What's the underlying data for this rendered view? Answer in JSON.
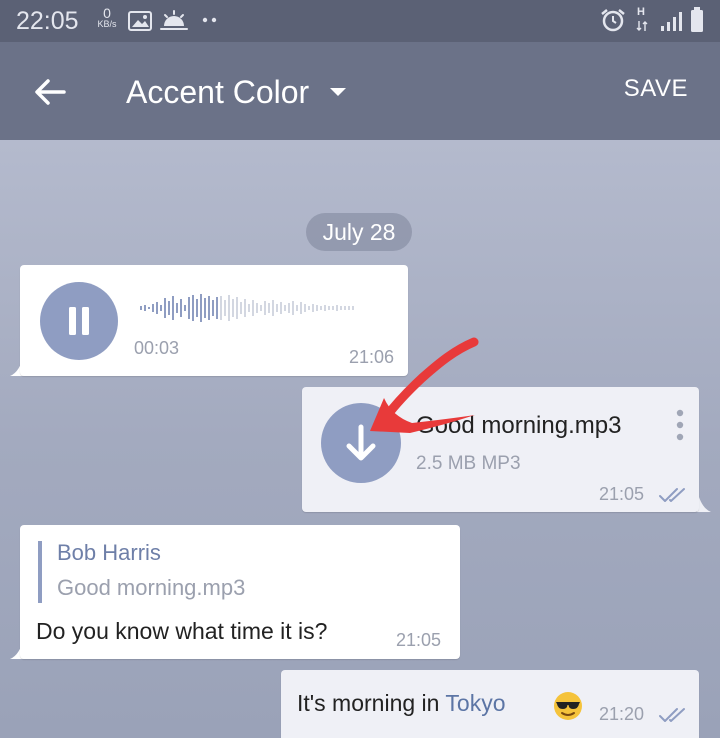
{
  "status_bar": {
    "time": "22:05",
    "data_speed": "0",
    "data_unit": "KB/s",
    "network_type": "H"
  },
  "app_bar": {
    "title": "Accent Color",
    "save_label": "SAVE"
  },
  "chat": {
    "date_label": "July 28",
    "voice_message": {
      "duration": "00:03",
      "time": "21:06"
    },
    "file_message": {
      "file_name": "Good morning.mp3",
      "file_meta": "2.5 MB MP3",
      "time": "21:05"
    },
    "reply_message": {
      "reply_author": "Bob Harris",
      "reply_text": "Good morning.mp3",
      "text": "Do you know what time it is?",
      "time": "21:05"
    },
    "last_message": {
      "text_before": "It's morning in ",
      "link": "Tokyo",
      "time": "21:20"
    }
  },
  "colors": {
    "accent": "#8f9dc2",
    "header": "#6b7288",
    "status_bar": "#5b6175",
    "annotation_arrow": "#e83a3a"
  },
  "icons": [
    "back-arrow-icon",
    "chevron-down-icon",
    "pause-icon",
    "download-icon",
    "more-vert-icon",
    "double-check-icon",
    "alarm-icon",
    "signal-icon",
    "battery-icon",
    "image-icon",
    "weather-icon"
  ]
}
